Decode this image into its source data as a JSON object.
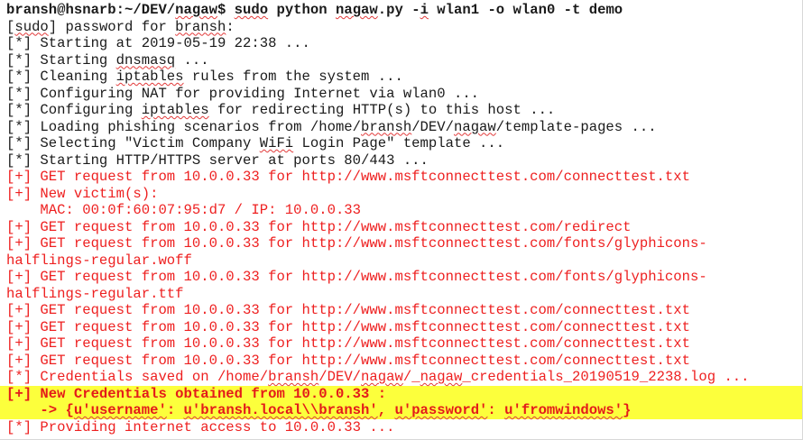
{
  "terminal": {
    "lines": [
      {
        "style": "bold",
        "parts": [
          {
            "t": "bransh@hsnarb:~/DEV/"
          },
          {
            "t": "nagaw",
            "sp": true
          },
          {
            "t": "$ "
          },
          {
            "t": "sudo",
            "sp": true
          },
          {
            "t": " python "
          },
          {
            "t": "nagaw",
            "sp": true
          },
          {
            "t": ".py -"
          },
          {
            "t": "i",
            "sp": true
          },
          {
            "t": " wlan1 -o wlan0 -t demo"
          }
        ]
      },
      {
        "style": "normal",
        "parts": [
          {
            "t": "["
          },
          {
            "t": "sudo",
            "sp": true
          },
          {
            "t": "] password for "
          },
          {
            "t": "bransh",
            "sp": true
          },
          {
            "t": ":"
          }
        ]
      },
      {
        "style": "normal",
        "parts": [
          {
            "t": "[*] Starting at 2019-05-19 22:38 ..."
          }
        ]
      },
      {
        "style": "normal",
        "parts": [
          {
            "t": "[*] Starting "
          },
          {
            "t": "dnsmasq",
            "sp": true
          },
          {
            "t": " ..."
          }
        ]
      },
      {
        "style": "normal",
        "parts": [
          {
            "t": "[*] Cleaning "
          },
          {
            "t": "iptables",
            "sp": true
          },
          {
            "t": " rules from the system ..."
          }
        ]
      },
      {
        "style": "normal",
        "parts": [
          {
            "t": "[*] Configuring NAT for providing Internet via wlan0 ..."
          }
        ]
      },
      {
        "style": "normal",
        "parts": [
          {
            "t": "[*] Configuring "
          },
          {
            "t": "iptables",
            "sp": true
          },
          {
            "t": " for redirecting HTTP(s) to this host ..."
          }
        ]
      },
      {
        "style": "normal",
        "parts": [
          {
            "t": "[*] Loading phishing scenarios from /home/"
          },
          {
            "t": "bransh",
            "sp": true
          },
          {
            "t": "/DEV/"
          },
          {
            "t": "nagaw",
            "sp": true
          },
          {
            "t": "/template-pages ..."
          }
        ]
      },
      {
        "style": "normal",
        "parts": [
          {
            "t": "[*] Selecting \"Victim Company "
          },
          {
            "t": "WiFi",
            "sp": true
          },
          {
            "t": " Login Page\" template ..."
          }
        ]
      },
      {
        "style": "normal",
        "parts": [
          {
            "t": "[*] Starting HTTP/HTTPS server at ports 80/443 ..."
          }
        ]
      },
      {
        "style": "red",
        "parts": [
          {
            "t": "[+] GET request from 10.0.0.33 for http://www.msftconnecttest.com/connecttest.txt"
          }
        ]
      },
      {
        "style": "red",
        "parts": [
          {
            "t": "[+] New victim(s):"
          }
        ]
      },
      {
        "style": "red",
        "parts": [
          {
            "t": "    MAC: 00:0f:60:07:95:d7 / IP: 10.0.0.33"
          }
        ]
      },
      {
        "style": "red",
        "parts": [
          {
            "t": "[+] GET request from 10.0.0.33 for http://www.msftconnecttest.com/redirect"
          }
        ]
      },
      {
        "style": "red",
        "parts": [
          {
            "t": "[+] GET request from 10.0.0.33 for http://www.msftconnecttest.com/fonts/glyphicons-"
          }
        ]
      },
      {
        "style": "red",
        "parts": [
          {
            "t": "halflings-regular.woff"
          }
        ]
      },
      {
        "style": "red",
        "parts": [
          {
            "t": "[+] GET request from 10.0.0.33 for http://www.msftconnecttest.com/fonts/glyphicons-"
          }
        ]
      },
      {
        "style": "red",
        "parts": [
          {
            "t": "halflings-regular.ttf"
          }
        ]
      },
      {
        "style": "red",
        "parts": [
          {
            "t": "[+] GET request from 10.0.0.33 for http://www.msftconnecttest.com/connecttest.txt"
          }
        ]
      },
      {
        "style": "red",
        "parts": [
          {
            "t": "[+] GET request from 10.0.0.33 for http://www.msftconnecttest.com/connecttest.txt"
          }
        ]
      },
      {
        "style": "red",
        "parts": [
          {
            "t": "[+] GET request from 10.0.0.33 for http://www.msftconnecttest.com/connecttest.txt"
          }
        ]
      },
      {
        "style": "red",
        "parts": [
          {
            "t": "[+] GET request from 10.0.0.33 for http://www.msftconnecttest.com/connecttest.txt"
          }
        ]
      },
      {
        "style": "red",
        "parts": [
          {
            "t": "[*] Credentials saved on /home/"
          },
          {
            "t": "bransh",
            "sp": true
          },
          {
            "t": "/DEV/"
          },
          {
            "t": "nagaw",
            "sp": true
          },
          {
            "t": "/_"
          },
          {
            "t": "nagaw",
            "sp": true
          },
          {
            "t": "_credentials_20190519_2238.log ..."
          }
        ]
      },
      {
        "style": "hl",
        "parts": [
          {
            "t": "[+] New Credentials obtained from 10.0.0.33 :"
          }
        ]
      },
      {
        "style": "hl",
        "parts": [
          {
            "t": "    -> {"
          },
          {
            "t": "u'username'",
            "sp": true
          },
          {
            "t": ": "
          },
          {
            "t": "u'bransh.local\\\\bransh'",
            "sp": true
          },
          {
            "t": ", "
          },
          {
            "t": "u'password'",
            "sp": true
          },
          {
            "t": ": "
          },
          {
            "t": "u'fromwindows'",
            "sp": true
          },
          {
            "t": "}"
          }
        ]
      },
      {
        "style": "red",
        "parts": [
          {
            "t": "[*] Providing internet access to 10.0.0.33 ..."
          }
        ]
      }
    ]
  }
}
